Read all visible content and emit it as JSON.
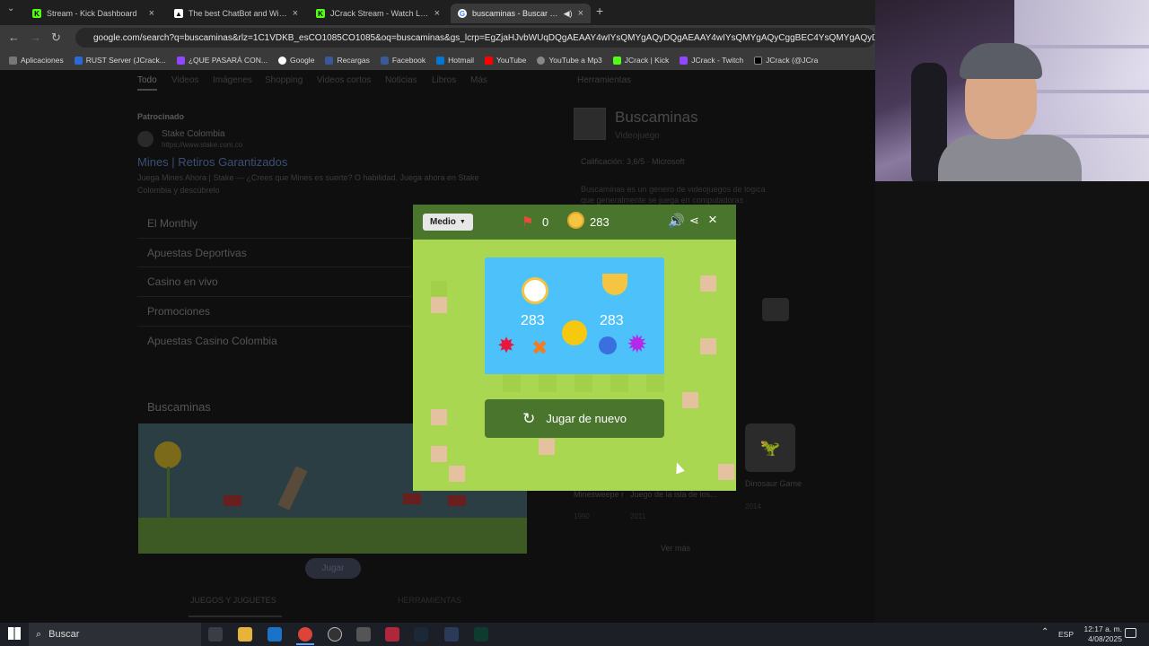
{
  "tabs": [
    {
      "title": "Stream - Kick Dashboard",
      "active": false
    },
    {
      "title": "The best ChatBot and Widgets",
      "active": false
    },
    {
      "title": "JCrack Stream - Watch Live on",
      "active": false
    },
    {
      "title": "buscaminas - Buscar con Go",
      "active": true
    }
  ],
  "address": {
    "url": "google.com/search?q=buscaminas&rlz=1C1VDKB_esCO1085CO1085&oq=buscaminas&gs_lcrp=EgZjaHJvbWUqDQgAEAAY4wIYsQMYgAQyDQgAEAAY4wIYsQMYgAQyCggBEC4YsQMYgAQyDQgCEAAYgwEYsQMYgAQyDQgDEAAY"
  },
  "bookmarks": [
    "Aplicaciones",
    "RUST Server (JCrack...",
    "¿QUE PASARÁ CON...",
    "Google",
    "Recargas",
    "Facebook",
    "Hotmail",
    "YouTube",
    "YouTube a Mp3",
    "JCrack | Kick",
    "JCrack - Twitch",
    "JCrack (@JCra"
  ],
  "search": {
    "tabs": [
      "Todo",
      "Videos",
      "Imágenes",
      "Shopping",
      "Videos cortos",
      "Noticias",
      "Libros",
      "Más",
      "Herramientas"
    ],
    "sponsored_label": "Patrocinado",
    "ad_source": "Stake Colombia",
    "ad_url": "https://www.stake.com.co",
    "ad_title": "Mines | Retiros Garantizados",
    "ad_desc_1": "Juega Mines Ahora | Stake — ¿Crees que Mines es suerte? O habilidad. Juega ahora en Stake",
    "ad_desc_2": "Colombia y descúbrelo",
    "ad_links": [
      "El Monthly",
      "Apuestas Deportivas",
      "Casino en vivo",
      "Promociones",
      "Apuestas Casino Colombia"
    ],
    "section_title": "Buscaminas",
    "play_button": "Jugar",
    "bottom_tabs": [
      "JUEGOS Y JUGUETES",
      "HERRAMIENTAS"
    ]
  },
  "knowledge": {
    "title": "Buscaminas",
    "subtitle": "Videojuego",
    "rating": "Calificación: 3,6/5 · Microsoft",
    "desc_1": "Buscaminas es un género de videojuegos de lógica",
    "desc_2": "que generalmente se juega en computadoras",
    "related": [
      {
        "name": "Minesweepe r",
        "year": "1990"
      },
      {
        "name": "Juego de la isla de los...",
        "year": "2011"
      },
      {
        "name": "Dinosaur Game",
        "year": "2014"
      }
    ],
    "see_more": "Ver más"
  },
  "game": {
    "difficulty": "Medio",
    "flags": "0",
    "timer": "283",
    "result_time": "283",
    "best_time": "283",
    "retry_label": "Jugar de nuevo"
  },
  "taskbar": {
    "search_placeholder": "Buscar",
    "lang": "ESP",
    "time": "12:17 a. m.",
    "date": "4/08/2025"
  }
}
